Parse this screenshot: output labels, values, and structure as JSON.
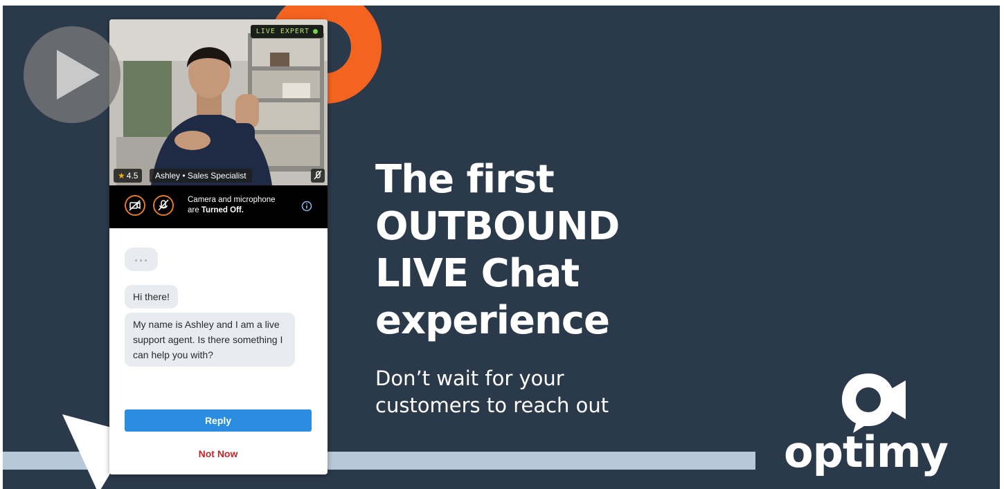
{
  "banner": {
    "headline_lines": [
      "The first",
      "OUTBOUND",
      "LIVE Chat",
      "experience"
    ],
    "subline_lines": [
      "Don’t wait for your",
      "customers to reach out"
    ],
    "logo_text": "optimy"
  },
  "video": {
    "live_badge": "LIVE EXPERT",
    "rating": "4.5",
    "agent_label": "Ashley • Sales Specialist"
  },
  "camera_bar": {
    "text_line1": "Camera and microphone",
    "text_prefix": "are ",
    "text_bold": "Turned Off."
  },
  "chat": {
    "messages": [
      "Hi there!",
      "My name is Ashley and I am a live support agent. Is there something I can help you with?"
    ],
    "reply_label": "Reply",
    "not_now_label": "Not Now"
  },
  "colors": {
    "background": "#2b3a4b",
    "accent_orange": "#f4641e",
    "reply_blue": "#2a8de0",
    "not_now_red": "#c0282b",
    "bar_light_blue": "#b7c8d8",
    "live_green": "#7ad24a"
  },
  "icons": {
    "play": "play-icon",
    "camera_off": "camera-off-icon",
    "mic_off": "mic-off-icon",
    "info": "info-icon",
    "star": "star-icon"
  }
}
